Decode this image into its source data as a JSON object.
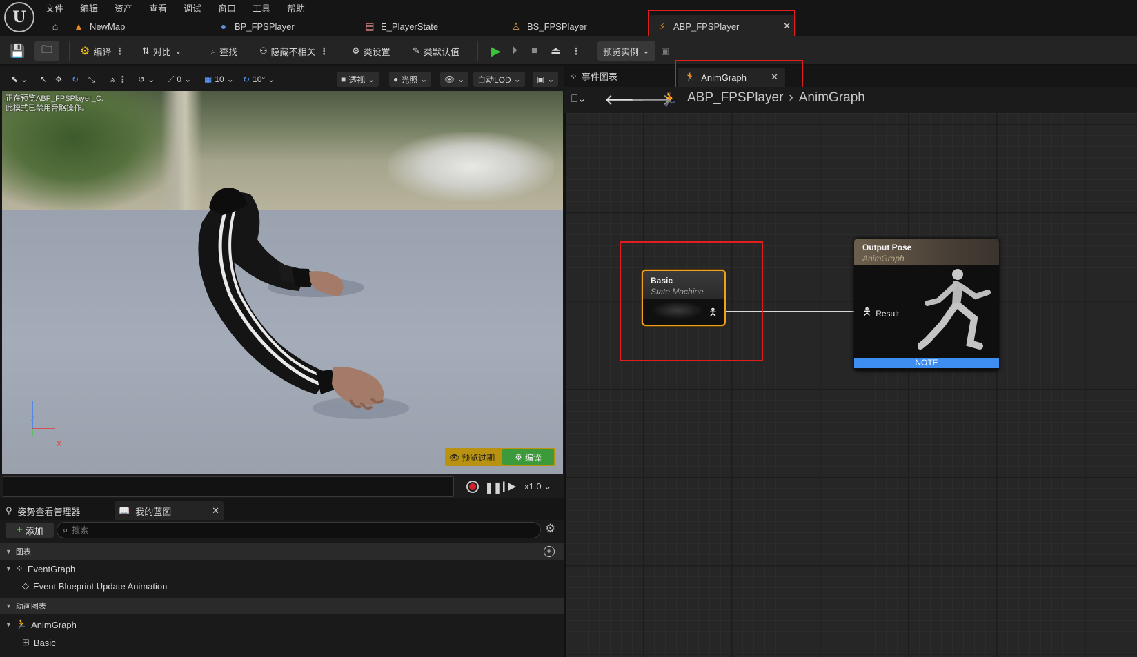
{
  "menu": [
    "文件",
    "编辑",
    "资产",
    "查看",
    "调试",
    "窗口",
    "工具",
    "帮助"
  ],
  "doc_tabs": {
    "home": "",
    "newmap": "NewMap",
    "bp_fpsplayer": "BP_FPSPlayer",
    "e_playerstate": "E_PlayerState",
    "bs_fpsplayer": "BS_FPSPlayer",
    "abp_fpsplayer": "ABP_FPSPlayer"
  },
  "toolbar": {
    "compile": "编译",
    "diff": "对比",
    "find": "查找",
    "hide_unrelated": "隐藏不相关",
    "class_settings": "类设置",
    "class_defaults": "类默认值",
    "preview_instance": "预览实例"
  },
  "viewport_toolbar": {
    "rotate_snap": "0",
    "grid_snap": "10",
    "angle_snap": "10°",
    "perspective": "透视",
    "lit": "光照",
    "lod": "自动LOD"
  },
  "viewport": {
    "info_line1": "正在预览ABP_FPSPlayer_C.",
    "info_line2": "此模式已禁用骨骼操作。",
    "axis_z": "Z",
    "axis_x": "X",
    "preview_outdated": "预览过期",
    "compile": "编译"
  },
  "playback": {
    "speed": "x1.0"
  },
  "bottom_tabs": {
    "pose_watch": "姿势查看管理器",
    "my_blueprint": "我的蓝图"
  },
  "my_blueprint": {
    "add": "添加",
    "search_placeholder": "搜索",
    "graphs_category": "图表",
    "event_graph": "EventGraph",
    "event_update": "Event Blueprint Update Animation",
    "anim_graphs_category": "动画图表",
    "anim_graph": "AnimGraph",
    "basic": "Basic"
  },
  "graph": {
    "tab_event": "事件图表",
    "tab_anim": "AnimGraph",
    "breadcrumb_root": "ABP_FPSPlayer",
    "breadcrumb_leaf": "AnimGraph",
    "node_basic_title": "Basic",
    "node_basic_sub": "State Machine",
    "node_output_title": "Output Pose",
    "node_output_sub": "AnimGraph",
    "output_pin": "Result",
    "note": "NOTE"
  },
  "colors": {
    "accent_orange": "#f0a01a",
    "play_green": "#3cc23c",
    "highlight_red": "#e01e1e",
    "note_blue": "#3d8ef0"
  }
}
